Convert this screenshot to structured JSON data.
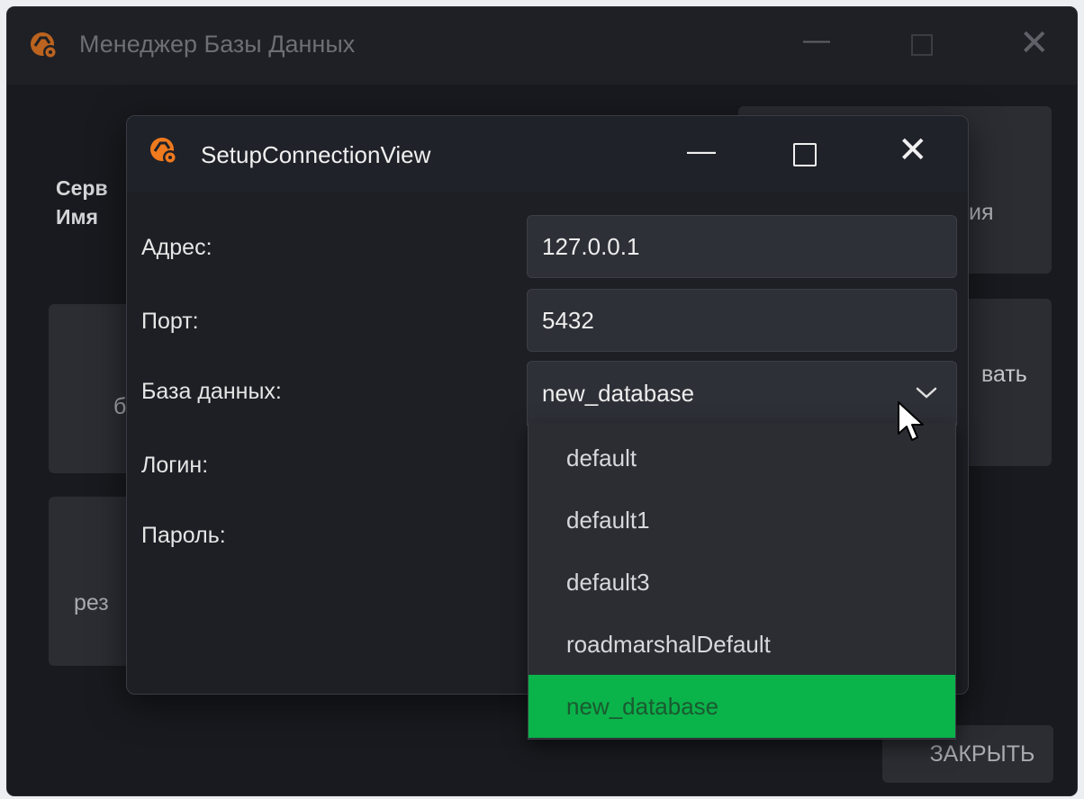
{
  "main_window": {
    "title": "Менеджер Базы Данных",
    "labels": {
      "line1": "Серв",
      "line2": "Имя"
    },
    "cards": {
      "a": "б",
      "b": "рез",
      "c": "ия",
      "d": "вать"
    },
    "close_label": "ЗАКРЫТЬ"
  },
  "dialog": {
    "title": "SetupConnectionView",
    "fields": {
      "address_label": "Адрес:",
      "address_value": "127.0.0.1",
      "port_label": "Порт:",
      "port_value": "5432",
      "database_label": "База данных:",
      "database_value": "new_database",
      "login_label": "Логин:",
      "password_label": "Пароль:"
    },
    "dropdown": {
      "options": [
        "default",
        "default1",
        "default3",
        "roadmarshalDefault",
        "new_database"
      ],
      "selected": "new_database"
    }
  },
  "colors": {
    "accent": "#0bb34b",
    "logo": "#f07a1e"
  }
}
